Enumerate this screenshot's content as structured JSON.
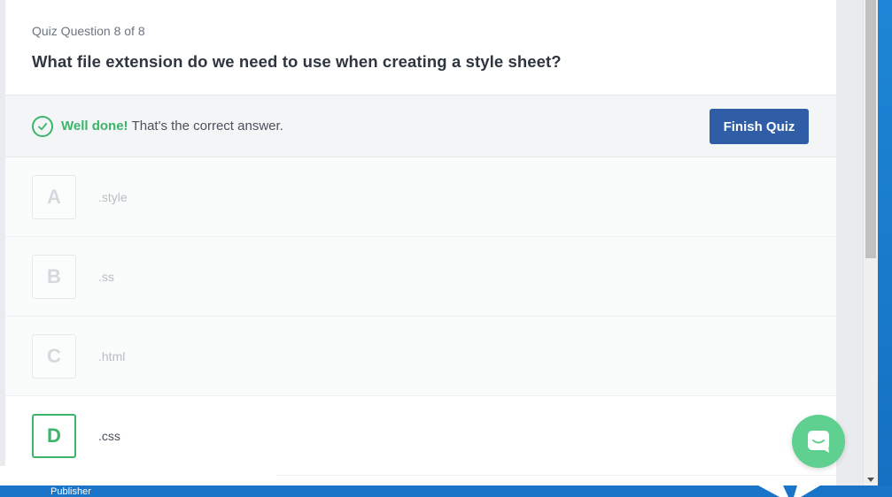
{
  "quiz": {
    "counter": "Quiz Question 8 of 8",
    "question": "What file extension do we need to use when creating a style sheet?"
  },
  "feedback": {
    "strong": "Well done!",
    "message": "That's the correct answer.",
    "icon": "check-circle-icon",
    "color": "#3bb56a"
  },
  "actions": {
    "finish_label": "Finish Quiz",
    "finish_color": "#2f5da6"
  },
  "options": [
    {
      "letter": "A",
      "label": ".style"
    },
    {
      "letter": "B",
      "label": ".ss"
    },
    {
      "letter": "C",
      "label": ".html"
    },
    {
      "letter": "D",
      "label": ".css"
    }
  ],
  "correct_option": "D",
  "chat": {
    "icon": "chat-bubble-icon",
    "color": "#5fd08f"
  },
  "taskbar": {
    "label": "Publisher"
  }
}
